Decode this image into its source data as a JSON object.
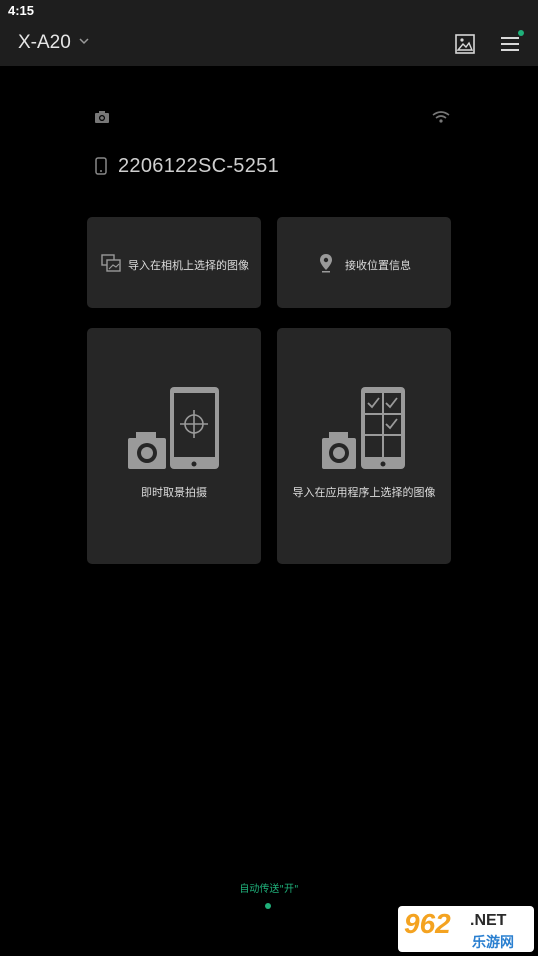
{
  "status_bar": {
    "time": "4:15"
  },
  "app_bar": {
    "title": "X-A20",
    "icons": [
      "chevron-down-icon",
      "gallery-icon",
      "hamburger-menu-icon"
    ]
  },
  "device": {
    "id": "2206122SC-5251",
    "icons": [
      "camera-icon",
      "wifi-icon",
      "smartphone-icon"
    ]
  },
  "cards": {
    "import_camera": {
      "label": "导入在相机上选择的图像",
      "icon": "import-image-icon"
    },
    "receive_location": {
      "label": "接收位置信息",
      "icon": "location-pin-icon"
    },
    "remote_shoot": {
      "label": "即时取景拍摄",
      "icon": "remote-shooting-icon"
    },
    "import_app": {
      "label": "导入在应用程序上选择的图像",
      "icon": "select-images-icon"
    }
  },
  "footer": {
    "auto_transfer": "自动传送\"开\""
  },
  "watermark": {
    "number": "962",
    "domain": ".NET",
    "site": "乐游网"
  },
  "colors": {
    "accent": "#1fb07a",
    "card": "#262626",
    "bar": "#1e1e1e"
  }
}
